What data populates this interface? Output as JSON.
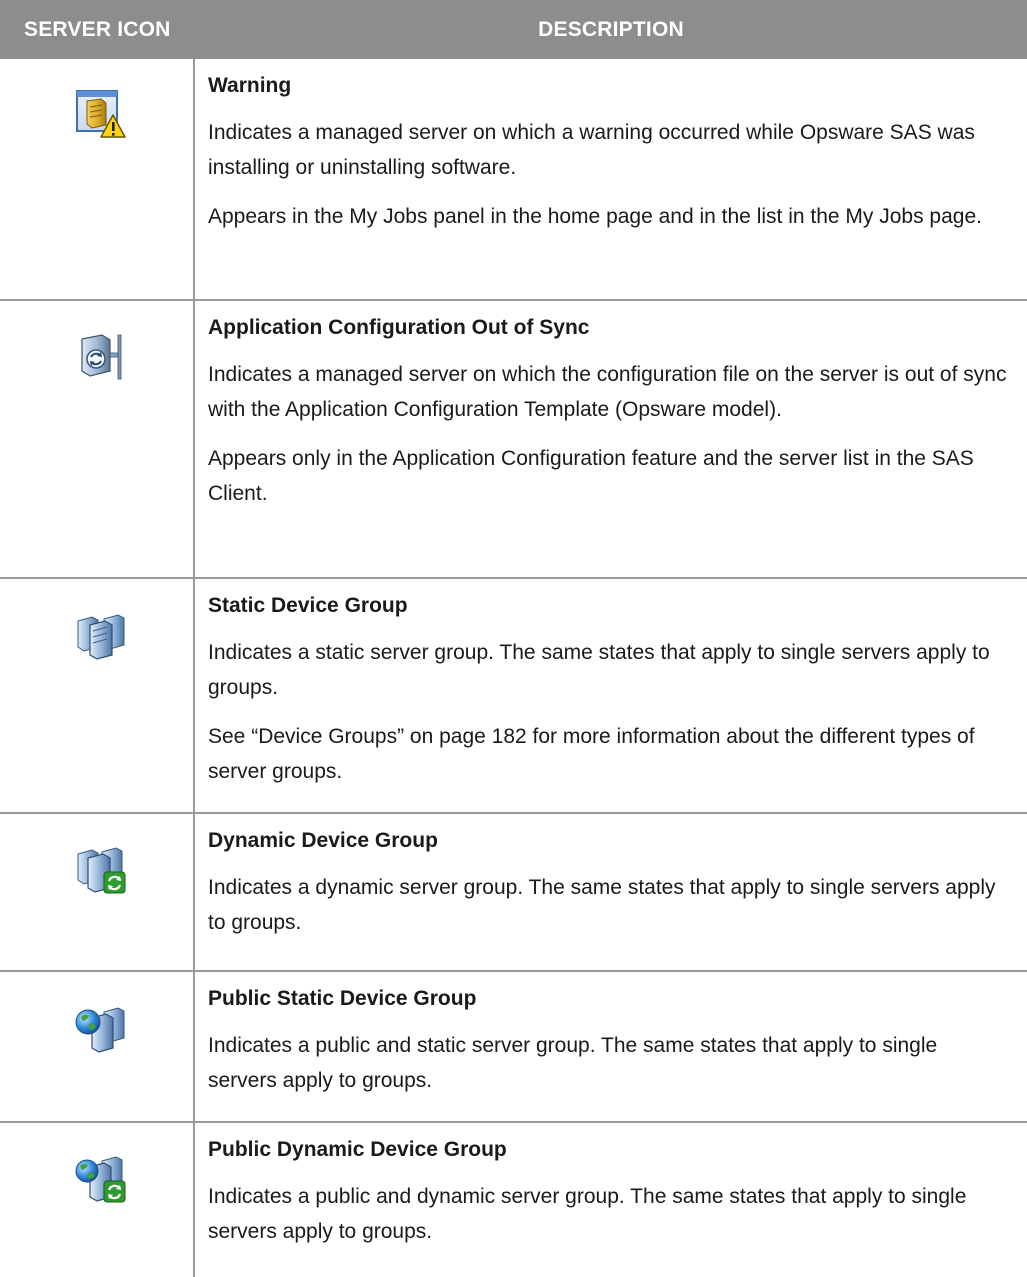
{
  "table": {
    "header": {
      "icon_col": "SERVER ICON",
      "desc_col": "DESCRIPTION"
    },
    "rows": [
      {
        "icon": "server-warning-icon",
        "title": "Warning",
        "paragraphs": [
          "Indicates a managed server on which a warning occurred while Opsware SAS was installing or uninstalling software.",
          "Appears in the My Jobs panel in the home page and in the list in the My Jobs page."
        ]
      },
      {
        "icon": "app-config-out-of-sync-icon",
        "title": "Application Configuration Out of Sync",
        "paragraphs": [
          "Indicates a managed server on which the configuration file on the server is out of sync with the Application Configuration Template (Opsware model).",
          "Appears only in the Application Configuration feature and the server list in the SAS Client."
        ]
      },
      {
        "icon": "static-device-group-icon",
        "title": "Static Device Group",
        "paragraphs": [
          "Indicates a static server group. The same states that apply to single servers apply to groups.",
          "See “Device Groups” on page 182 for more information about the different types of server groups."
        ]
      },
      {
        "icon": "dynamic-device-group-icon",
        "title": "Dynamic Device Group",
        "paragraphs": [
          "Indicates a dynamic server group. The same states that apply to single servers apply to groups."
        ]
      },
      {
        "icon": "public-static-device-group-icon",
        "title": "Public Static Device Group",
        "paragraphs": [
          "Indicates a public and static server group. The same states that apply to single servers apply to groups."
        ]
      },
      {
        "icon": "public-dynamic-device-group-icon",
        "title": "Public Dynamic Device Group",
        "paragraphs": [
          "Indicates a public and dynamic server group. The same states that apply to single servers apply to groups."
        ]
      }
    ]
  }
}
